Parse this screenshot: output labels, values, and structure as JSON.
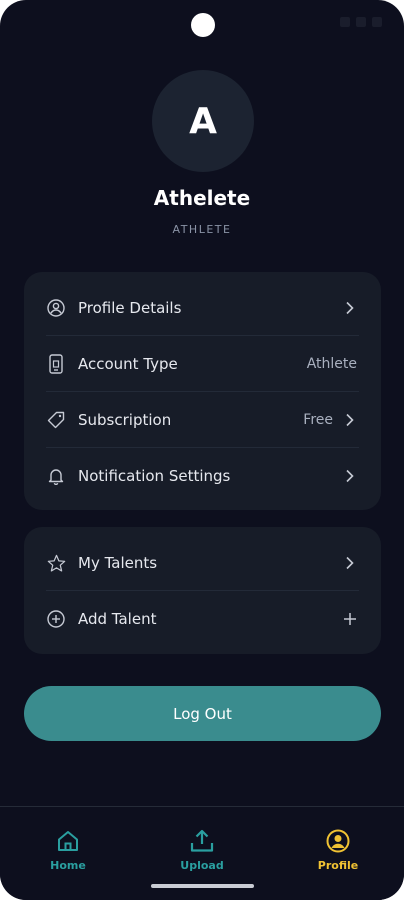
{
  "profile": {
    "avatar_letter": "A",
    "name": "Athelete",
    "role": "ATHLETE"
  },
  "settings_card": [
    {
      "label": "Profile Details",
      "icon": "user-circle-icon",
      "value": "",
      "action": "chevron-right-icon"
    },
    {
      "label": "Account Type",
      "icon": "phone-icon",
      "value": "Athlete",
      "action": ""
    },
    {
      "label": "Subscription",
      "icon": "tag-icon",
      "value": "Free",
      "action": "chevron-right-icon"
    },
    {
      "label": "Notification Settings",
      "icon": "bell-icon",
      "value": "",
      "action": "chevron-right-icon"
    }
  ],
  "talents_card": [
    {
      "label": "My Talents",
      "icon": "star-icon",
      "action": "chevron-right-icon"
    },
    {
      "label": "Add Talent",
      "icon": "plus-circle-icon",
      "action": "plus-icon"
    }
  ],
  "logout_label": "Log Out",
  "bottom_nav": [
    {
      "label": "Home",
      "icon": "home-icon",
      "color": "#2a9fa0"
    },
    {
      "label": "Upload",
      "icon": "upload-icon",
      "color": "#2a9fa0"
    },
    {
      "label": "Profile",
      "icon": "profile-icon",
      "color": "#f0c233",
      "active": true
    }
  ],
  "colors": {
    "background": "#0d0f1e",
    "card": "#171c28",
    "accent_teal": "#3a8c8e",
    "active_yellow": "#f0c233"
  }
}
